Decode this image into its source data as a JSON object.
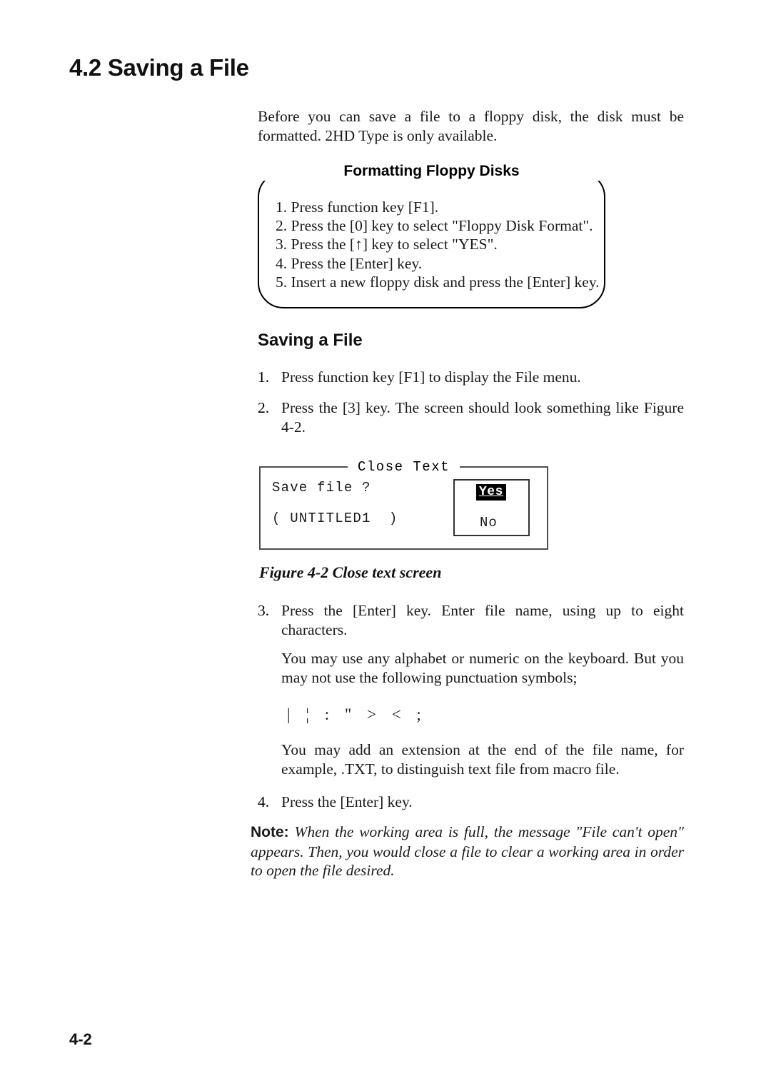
{
  "page": {
    "section_number_title": "4.2 Saving a File",
    "page_number": "4-2"
  },
  "intro": {
    "paragraph": "Before you can save a file to a floppy disk, the disk must be formatted. 2HD Type is only available."
  },
  "callout": {
    "title": "Formatting Floppy Disks",
    "steps": [
      "1. Press function key [F1].",
      "2. Press the [0] key to select \"Floppy Disk Format\".",
      "3. Press the [↑] key to select \"YES\".",
      "4. Press the [Enter] key.",
      "5. Insert a new floppy disk and press the [Enter] key."
    ]
  },
  "subsection": {
    "heading": "Saving a File",
    "steps": [
      {
        "number": "1.",
        "text": "Press function key [F1] to display the File menu."
      },
      {
        "number": "2.",
        "text": "Press the [3] key. The screen should look something like Figure 4-2."
      },
      {
        "number": "3.",
        "text": "Press the [Enter] key. Enter file name, using up to eight characters."
      },
      {
        "number": "4.",
        "text": "Press the [Enter] key."
      }
    ],
    "note_alphabet": "You may use any alphabet or numeric on the keyboard. But you may not use the following punctuation symbols;",
    "forbidden_symbols": "| ¦ : \"  >  <  ;",
    "note_extension": "You may add an extension at the end of the file name, for example, .TXT, to distinguish text file from macro file."
  },
  "figure": {
    "window_title": "Close Text",
    "prompt": "Save file ?",
    "filename": "( UNTITLED1  )",
    "choice_selected": "Yes",
    "choice_other": "No",
    "caption": "Figure 4-2 Close text screen"
  },
  "note": {
    "label": "Note:",
    "text": "When the working area is full, the message \"File can't open\" appears. Then, you would close a file to clear a working area in order to open the file desired."
  }
}
